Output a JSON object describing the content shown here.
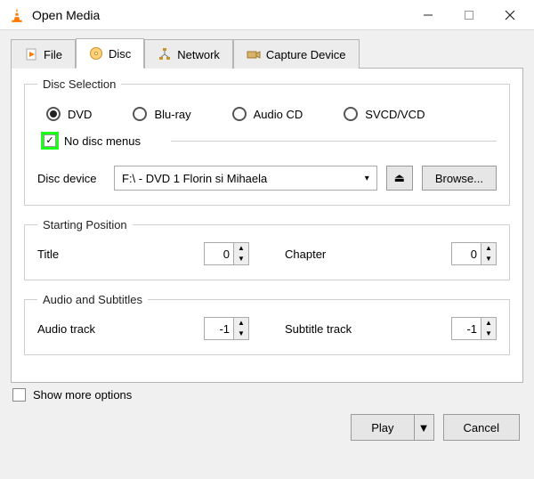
{
  "window": {
    "title": "Open Media"
  },
  "tabs": [
    {
      "label": "File"
    },
    {
      "label": "Disc"
    },
    {
      "label": "Network"
    },
    {
      "label": "Capture Device"
    }
  ],
  "disc_selection": {
    "legend": "Disc Selection",
    "options": {
      "dvd": "DVD",
      "bluray": "Blu-ray",
      "audiocd": "Audio CD",
      "svcd": "SVCD/VCD"
    },
    "no_menus_label": "No disc menus",
    "no_menus_checked": true,
    "checkmark": "✓",
    "device_label": "Disc device",
    "device_value": "F:\\ - DVD 1 Florin si Mihaela",
    "browse_label": "Browse...",
    "eject_glyph": "⏏"
  },
  "starting_position": {
    "legend": "Starting Position",
    "title_label": "Title",
    "title_value": "0",
    "chapter_label": "Chapter",
    "chapter_value": "0"
  },
  "audio_subs": {
    "legend": "Audio and Subtitles",
    "audio_label": "Audio track",
    "audio_value": "-1",
    "subtitle_label": "Subtitle track",
    "subtitle_value": "-1"
  },
  "footer": {
    "show_more_label": "Show more options",
    "play_label": "Play",
    "cancel_label": "Cancel"
  }
}
